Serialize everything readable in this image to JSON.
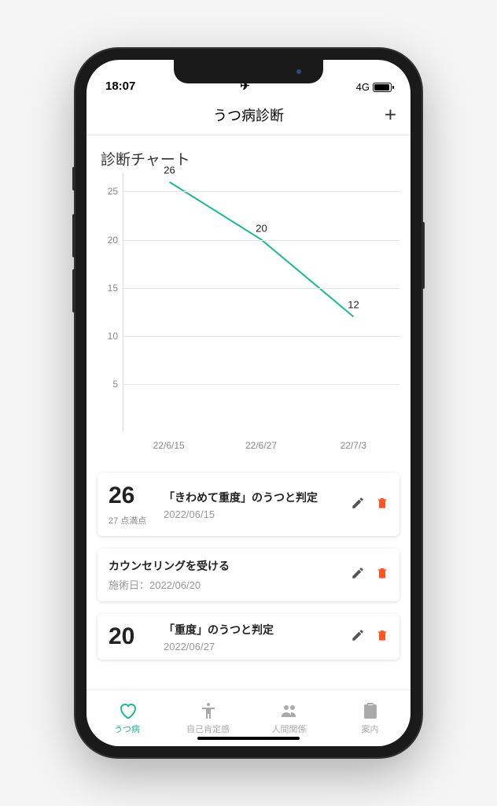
{
  "status": {
    "time": "18:07",
    "network": "4G"
  },
  "header": {
    "title": "うつ病診断",
    "add_label": "+"
  },
  "chart_title": "診断チャート",
  "chart_data": {
    "type": "line",
    "categories": [
      "22/6/15",
      "22/6/27",
      "22/7/3"
    ],
    "values": [
      26,
      20,
      12
    ],
    "ylim": [
      0,
      27
    ],
    "yticks": [
      5,
      10,
      15,
      20,
      25
    ],
    "line_color": "#1db894"
  },
  "score_caption": "27 点満点",
  "cards": [
    {
      "score": "26",
      "title": "「きわめて重度」のうつと判定",
      "date": "2022/06/15",
      "show_score": true
    },
    {
      "title": "カウンセリングを受ける",
      "date": "施術日：2022/06/20",
      "show_score": false
    },
    {
      "score": "20",
      "title": "「重度」のうつと判定",
      "date": "2022/06/27",
      "show_score": true
    }
  ],
  "nav": [
    {
      "label": "うつ病",
      "icon": "heart",
      "active": true
    },
    {
      "label": "自己肯定感",
      "icon": "body",
      "active": false
    },
    {
      "label": "人間関係",
      "icon": "people",
      "active": false
    },
    {
      "label": "案内",
      "icon": "clipboard",
      "active": false
    }
  ]
}
